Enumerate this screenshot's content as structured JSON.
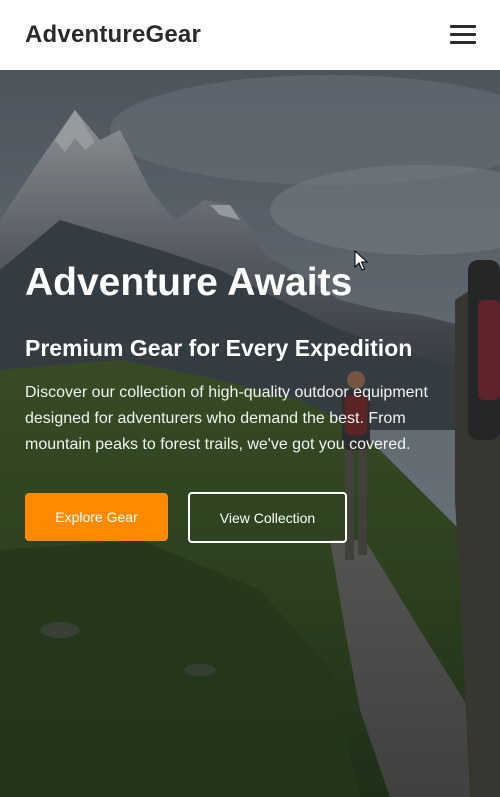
{
  "header": {
    "brand": "AdventureGear",
    "menu_icon": "hamburger-menu-icon"
  },
  "hero": {
    "title": "Adventure Awaits",
    "subtitle": "Premium Gear for Every Expedition",
    "description": "Discover our collection of high-quality outdoor equipment designed for adventurers who demand the best. From mountain peaks to forest trails, we've got you covered.",
    "primary_cta": "Explore Gear",
    "secondary_cta": "View Collection",
    "background": "mountain-hiking-trail-photo"
  },
  "colors": {
    "accent": "#ff8a00",
    "header_text": "#2b2b2b",
    "hero_text": "#ffffff"
  }
}
